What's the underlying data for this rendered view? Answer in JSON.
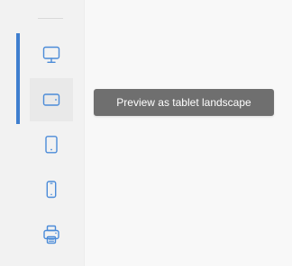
{
  "sidebar": {
    "devices": [
      {
        "label": "Preview as desktop",
        "icon": "desktop-icon",
        "selected": false
      },
      {
        "label": "Preview as tablet landscape",
        "icon": "tablet-landscape-icon",
        "selected": true
      },
      {
        "label": "Preview as tablet portrait",
        "icon": "tablet-portrait-icon",
        "selected": false
      },
      {
        "label": "Preview as mobile",
        "icon": "mobile-icon",
        "selected": false
      },
      {
        "label": "Print preview",
        "icon": "print-icon",
        "selected": false
      }
    ]
  },
  "tooltip": {
    "text": "Preview as tablet landscape"
  },
  "colors": {
    "accent": "#3f7fcf",
    "icon": "#4b8bd8",
    "tooltip_bg": "#6f6f6f",
    "sidebar_bg": "#f2f2f2",
    "page_bg": "#f8f8f8"
  }
}
